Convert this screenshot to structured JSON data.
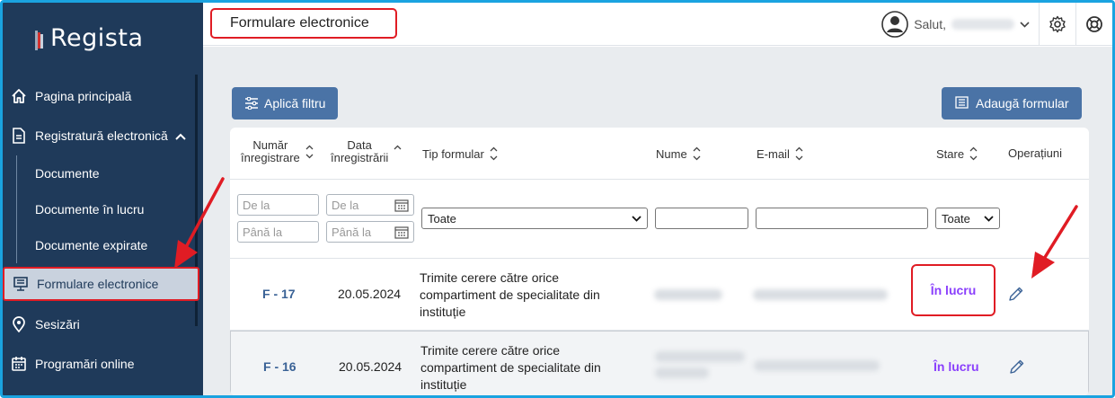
{
  "app": {
    "logo_text": "Regista"
  },
  "sidebar": {
    "items": [
      {
        "label": "Pagina principală"
      },
      {
        "label": "Registratură electronică"
      },
      {
        "label": "Formulare electronice"
      },
      {
        "label": "Sesizări"
      },
      {
        "label": "Programări online"
      }
    ],
    "sub_items": [
      {
        "label": "Documente"
      },
      {
        "label": "Documente în lucru"
      },
      {
        "label": "Documente expirate"
      }
    ]
  },
  "header": {
    "title": "Formulare electronice",
    "greeting": "Salut,"
  },
  "toolbar": {
    "filter_label": "Aplică filtru",
    "add_label": "Adaugă formular"
  },
  "table": {
    "columns": {
      "numar_line1": "Număr",
      "numar_line2": "înregistrare",
      "data_line1": "Data",
      "data_line2": "înregistrării",
      "tip": "Tip formular",
      "nume": "Nume",
      "email": "E-mail",
      "stare": "Stare",
      "operatiuni": "Operațiuni"
    },
    "filters": {
      "from_placeholder": "De la",
      "to_placeholder": "Până la",
      "tip_selected": "Toate",
      "stare_selected": "Toate"
    },
    "rows": [
      {
        "numar": "F - 17",
        "data": "20.05.2024",
        "tip_line1": "Trimite cerere către orice",
        "tip_line2": "compartiment de specialitate din",
        "tip_line3": "instituție",
        "stare": "În lucru"
      },
      {
        "numar": "F - 16",
        "data": "20.05.2024",
        "tip_line1": "Trimite cerere către orice",
        "tip_line2": "compartiment de specialitate din",
        "tip_line3": "instituție",
        "stare": "În lucru"
      }
    ]
  },
  "colors": {
    "sidebar_bg": "#1f3a5a",
    "accent_button": "#4a73a6",
    "status_text": "#8a3ffc",
    "highlight_red": "#e01c24",
    "frame_blue": "#1aa3e0"
  },
  "icons": {
    "home": "home-icon",
    "registry": "document-icon",
    "forms": "monitor-form-icon",
    "sesizari": "location-pin-icon",
    "programari": "calendar-icon",
    "settings": "gear-icon",
    "help": "lifebuoy-icon",
    "edit": "pencil-icon"
  }
}
